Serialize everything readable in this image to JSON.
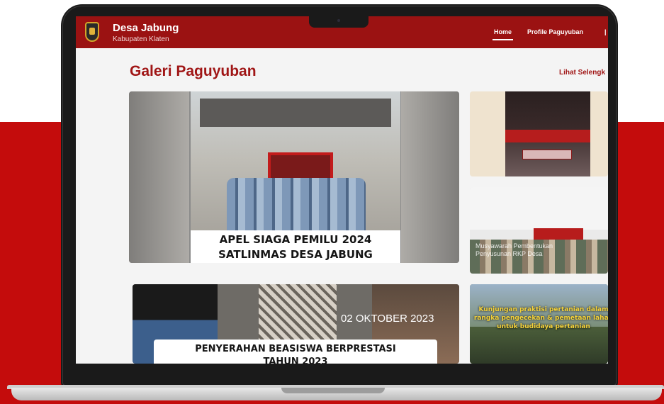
{
  "header": {
    "brand_title": "Desa Jabung",
    "brand_subtitle": "Kabupaten Klaten",
    "nav": [
      "Home",
      "Profile Paguyuban"
    ]
  },
  "main": {
    "section_title": "Galeri Paguyuban",
    "see_all_label": "Lihat Selengk"
  },
  "gallery": {
    "tile1": {
      "caption_line1": "APEL SIAGA PEMILU 2024",
      "caption_line2": "SATLINMAS DESA JABUNG"
    },
    "tile2": {
      "sign_text": "PELATIHAN"
    },
    "tile3": {
      "watermark": "Musyawarah Pembentukan Penyusunan RKP Desa"
    },
    "tile4": {
      "date": "02 OKTOBER 2023",
      "caption_line1": "PENYERAHAN BEASISWA BERPRESTASI",
      "caption_line2": "TAHUN 2023"
    },
    "tile5": {
      "caption": "Kunjungan praktisi pertanian dalam rangka pengecekan & pemetaan lahan untuk budidaya pertanian"
    }
  },
  "colors": {
    "brand_red": "#9b1212",
    "backdrop_red": "#c40c0c",
    "title_red": "#a01616"
  }
}
